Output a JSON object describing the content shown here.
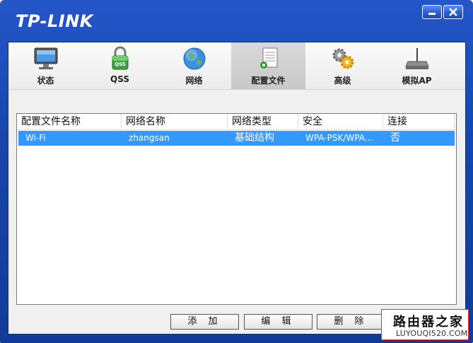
{
  "window": {
    "logo": "TP-LINK",
    "accent": "#1a48b0"
  },
  "toolbar": {
    "items": [
      {
        "label": "状态",
        "icon": "monitor-icon"
      },
      {
        "label": "QSS",
        "icon": "qss-lock-icon",
        "badge": "QSS"
      },
      {
        "label": "网络",
        "icon": "globe-icon"
      },
      {
        "label": "配置文件",
        "icon": "profile-document-icon"
      },
      {
        "label": "高级",
        "icon": "gears-icon"
      },
      {
        "label": "模拟AP",
        "icon": "router-icon"
      }
    ],
    "active": "配置文件"
  },
  "profiles": {
    "columns": [
      "配置文件名称",
      "网络名称",
      "网络类型",
      "安全",
      "连接"
    ],
    "rows": [
      [
        "Wi-Fi",
        "zhangsan",
        "基础结构",
        "WPA-PSK/WPA…",
        "否"
      ]
    ],
    "selected_color": "#3399ff"
  },
  "actions": {
    "add": "添 加",
    "edit": "编 辑",
    "delete": "删 除"
  },
  "watermark": {
    "title": "路由器之家",
    "url": "LUYOUQI520.COM"
  }
}
